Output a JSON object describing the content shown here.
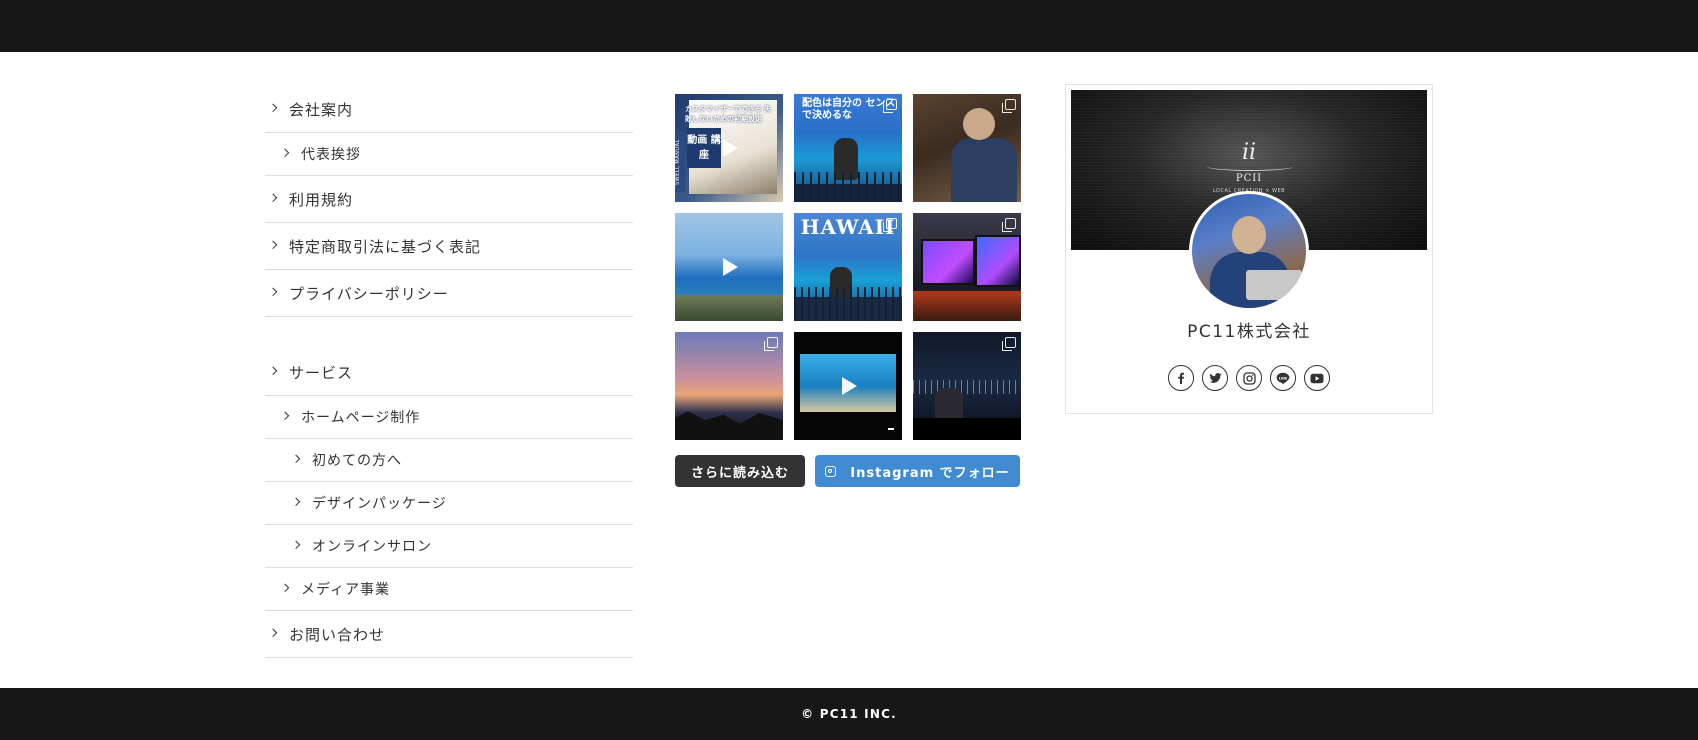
{
  "menu": {
    "groups": [
      [
        {
          "label": "会社案内",
          "level": 0
        },
        {
          "label": "代表挨拶",
          "level": 1
        },
        {
          "label": "利用規約",
          "level": 0
        },
        {
          "label": "特定商取引法に基づく表記",
          "level": 0
        },
        {
          "label": "プライバシーポリシー",
          "level": 0
        }
      ],
      [
        {
          "label": "サービス",
          "level": 0
        },
        {
          "label": "ホームページ制作",
          "level": 1
        },
        {
          "label": "初めての方へ",
          "level": 2
        },
        {
          "label": "デザインパッケージ",
          "level": 2
        },
        {
          "label": "オンラインサロン",
          "level": 2
        },
        {
          "label": "メディア事業",
          "level": 1
        },
        {
          "label": "お問い合わせ",
          "level": 0
        }
      ]
    ]
  },
  "instagram": {
    "tiles": [
      {
        "caption": "カスタマイザーでできる 失敗しないための初期設定",
        "badge": "動画 講座",
        "side": "SWELL MANUAL",
        "type": "video"
      },
      {
        "caption": "配色は自分の センスで決めるな",
        "type": "carousel"
      },
      {
        "type": "carousel"
      },
      {
        "type": "video"
      },
      {
        "caption": "HAWAII",
        "type": "carousel"
      },
      {
        "type": "carousel"
      },
      {
        "type": "carousel"
      },
      {
        "type": "video"
      },
      {
        "type": "carousel"
      }
    ],
    "load_more_label": "さらに読み込む",
    "follow_label": "Instagram でフォロー"
  },
  "profile": {
    "logo_mark": "ii",
    "logo_text": "PCII",
    "logo_sub": "LOCAL CREATION × WEB",
    "name": "PC11株式会社",
    "socials": [
      "facebook-icon",
      "twitter-icon",
      "instagram-icon",
      "line-icon",
      "youtube-icon"
    ]
  },
  "footer": {
    "copyright": "© PC11 INC."
  }
}
